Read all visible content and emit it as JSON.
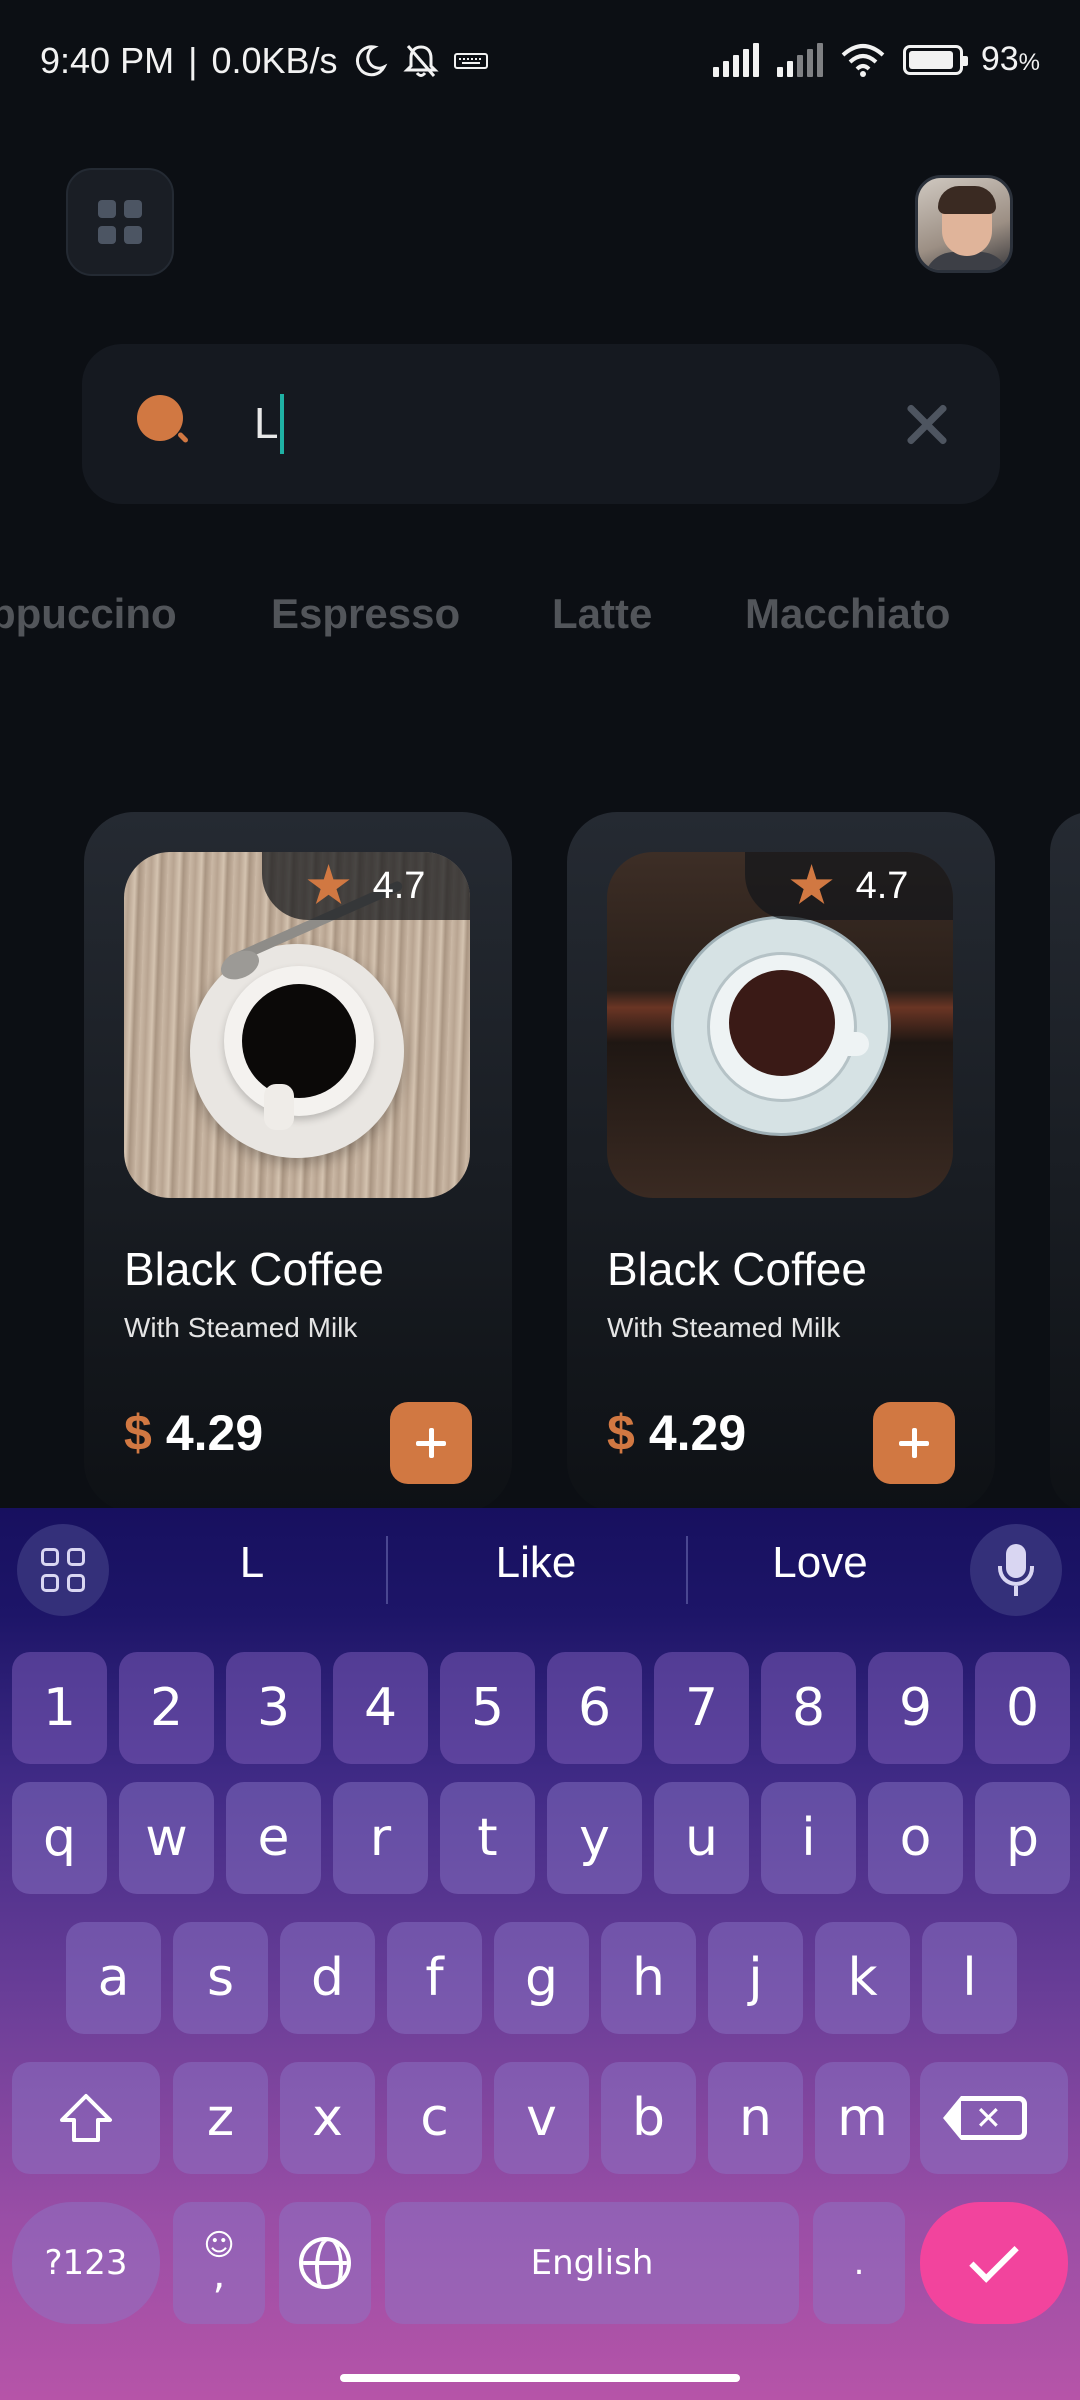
{
  "status_bar": {
    "time": "9:40 PM",
    "separator": "|",
    "net_speed": "0.0KB/s",
    "battery": "93",
    "battery_unit": "%",
    "battery_level": 0.93,
    "icons": [
      "moon-icon",
      "bell-off-icon",
      "keyboard-icon",
      "signal-icon",
      "wifi-icon",
      "battery-icon"
    ]
  },
  "header": {
    "menu_icon": "grid-icon",
    "avatar": "user-avatar"
  },
  "search": {
    "value": "L",
    "icon": "search-icon",
    "clear_icon": "close-icon"
  },
  "categories": [
    "ppuccino",
    "Espresso",
    "Latte",
    "Macchiato"
  ],
  "products": [
    {
      "rating": "4.7",
      "name": "Black Coffee",
      "subtitle": "With Steamed Milk",
      "currency": "$",
      "price": "4.29",
      "add_label": "+"
    },
    {
      "rating": "4.7",
      "name": "Black Coffee",
      "subtitle": "With Steamed Milk",
      "currency": "$",
      "price": "4.29",
      "add_label": "+"
    }
  ],
  "keyboard": {
    "suggestions": [
      "L",
      "Like",
      "Love"
    ],
    "row_numbers": [
      "1",
      "2",
      "3",
      "4",
      "5",
      "6",
      "7",
      "8",
      "9",
      "0"
    ],
    "row1": [
      "q",
      "w",
      "e",
      "r",
      "t",
      "y",
      "u",
      "i",
      "o",
      "p"
    ],
    "row2": [
      "a",
      "s",
      "d",
      "f",
      "g",
      "h",
      "j",
      "k",
      "l"
    ],
    "row3": [
      "z",
      "x",
      "c",
      "v",
      "b",
      "n",
      "m"
    ],
    "symbols_label": "?123",
    "comma_label": ",",
    "emoji_label": "☺",
    "space_label": "English",
    "period_label": "."
  },
  "colors": {
    "accent": "#D17842",
    "background": "#0C0F14",
    "enter_key": "#F2449D"
  }
}
